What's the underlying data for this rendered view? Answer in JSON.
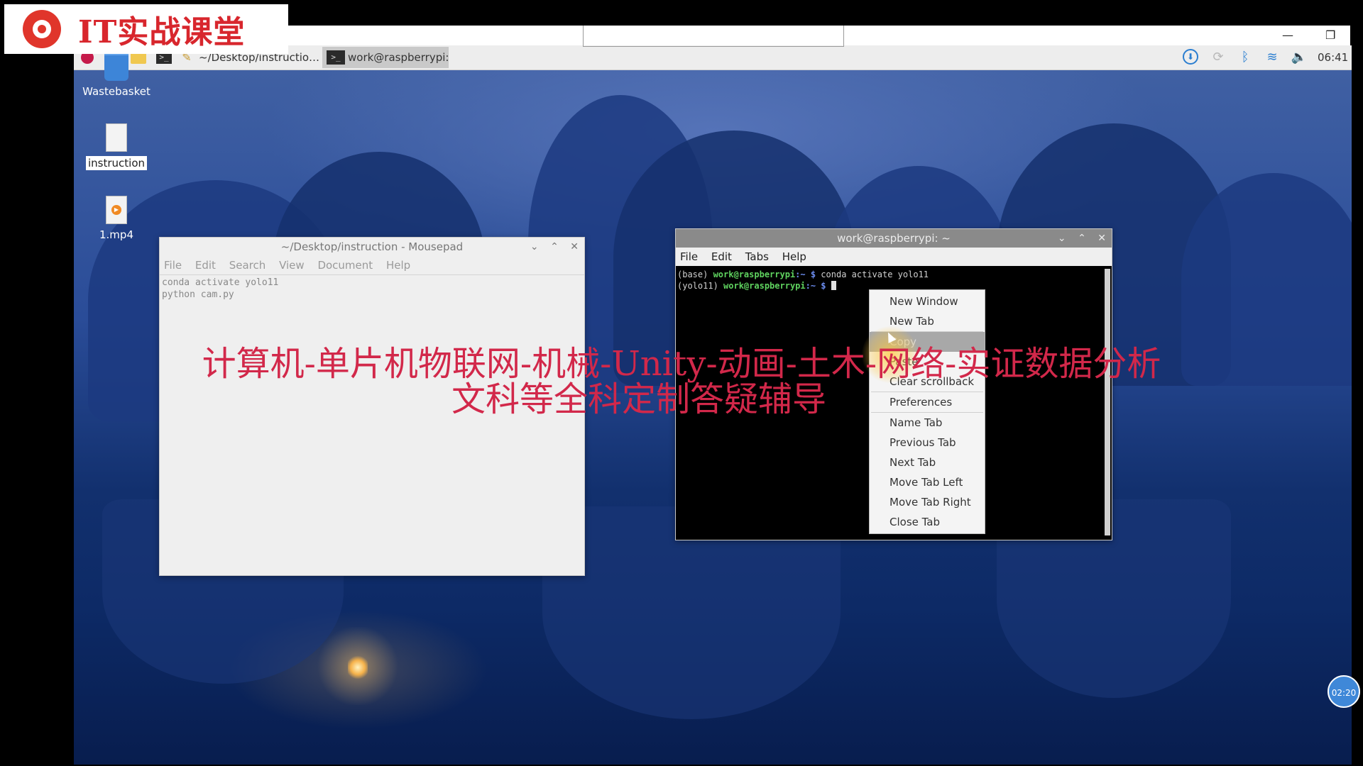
{
  "logo": {
    "text": "IT实战课堂"
  },
  "taskbar": {
    "tasks": [
      {
        "label": "~/Desktop/instructio…"
      },
      {
        "label": "work@raspberrypi: ~"
      }
    ],
    "clock": "06:41",
    "term_icon_glyph": ">_"
  },
  "desktop_icons": [
    {
      "label": "Wastebasket",
      "icon": "trash-icon"
    },
    {
      "label": "instruction",
      "icon": "text-file-icon"
    },
    {
      "label": "1.mp4",
      "icon": "video-file-icon"
    }
  ],
  "mousepad": {
    "title": "~/Desktop/instruction - Mousepad",
    "menu": [
      "File",
      "Edit",
      "Search",
      "View",
      "Document",
      "Help"
    ],
    "content": "conda activate yolo11\npython cam.py"
  },
  "terminal": {
    "title": "work@raspberrypi: ~",
    "menu": [
      "File",
      "Edit",
      "Tabs",
      "Help"
    ],
    "lines": [
      {
        "env": "(base) ",
        "user": "work@raspberrypi",
        "path": ":~ $ ",
        "cmd": "conda activate yolo11"
      },
      {
        "env": "(yolo11) ",
        "user": "work@raspberrypi",
        "path": ":~ $ ",
        "cmd": ""
      }
    ]
  },
  "context_menu": {
    "items": [
      "New Window",
      "New Tab",
      "Copy",
      "Paste",
      "Clear scrollback",
      "Preferences",
      "Name Tab",
      "Previous Tab",
      "Next Tab",
      "Move Tab Left",
      "Move Tab Right",
      "Close Tab"
    ]
  },
  "watermark": {
    "line1": "计算机-单片机物联网-机械-Unity-动画-土木-网络-实证数据分析",
    "line2": "文科等全科定制答疑辅导"
  },
  "timer_badge": "02:20",
  "colors": {
    "logo_red": "#d8262d",
    "watermark": "#d2284a",
    "term_green": "#5fd35f",
    "term_blue": "#6c8df0",
    "desktop_blue": "#2a4c98"
  }
}
